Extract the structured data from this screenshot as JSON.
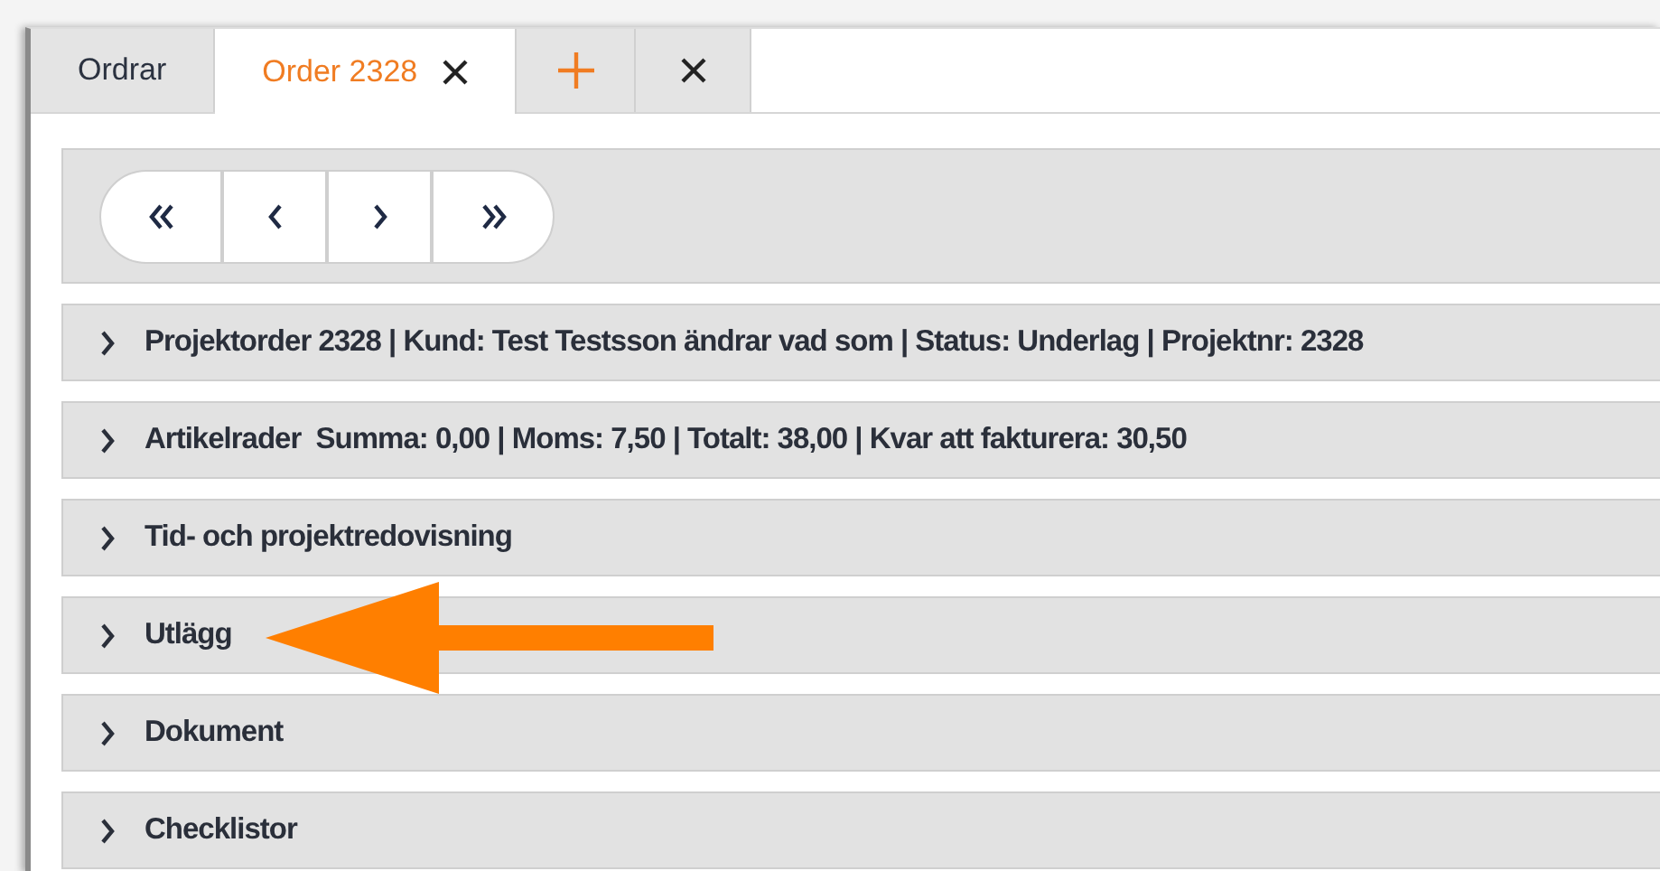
{
  "tabs": [
    {
      "label": "Ordrar",
      "selected": false,
      "closable": false
    },
    {
      "label": "Order 2328",
      "selected": true,
      "closable": true
    }
  ],
  "tab_actions": [
    {
      "kind": "add"
    },
    {
      "kind": "close"
    }
  ],
  "nav_buttons": [
    {
      "kind": "first"
    },
    {
      "kind": "previous"
    },
    {
      "kind": "next"
    },
    {
      "kind": "last"
    }
  ],
  "sections": [
    {
      "title": "Projektorder 2328 | Kund: Test Testsson ändrar vad som | Status: Underlag | Projektnr: 2328",
      "expanded": false
    },
    {
      "title": "Artikelrader  Summa: 0,00 | Moms: 7,50 | Totalt: 38,00 | Kvar att fakturera: 30,50",
      "expanded": false
    },
    {
      "title": "Tid- och projektredovisning",
      "expanded": false
    },
    {
      "title": "Utlägg",
      "expanded": false
    },
    {
      "title": "Dokument",
      "expanded": false
    },
    {
      "title": "Checklistor",
      "expanded": false
    }
  ],
  "annotation": {
    "kind": "arrow"
  }
}
